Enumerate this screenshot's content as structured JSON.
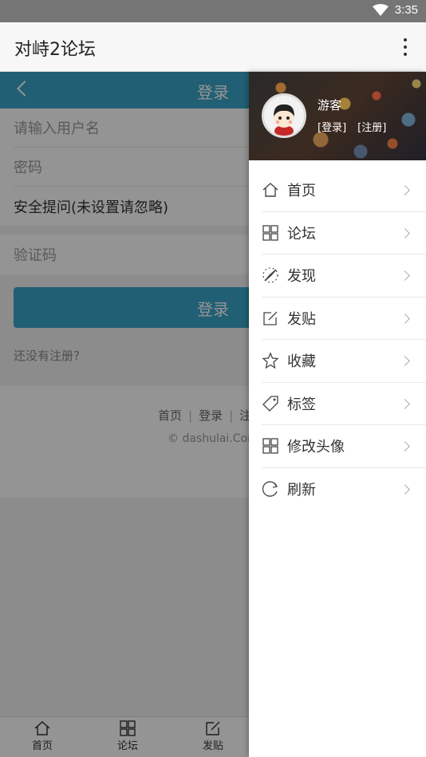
{
  "status_bar": {
    "time": "3:35"
  },
  "app_bar": {
    "title": "对峙2论坛"
  },
  "login_page": {
    "header_title": "登录",
    "username_placeholder": "请输入用户名",
    "password_placeholder": "密码",
    "security_question": "安全提问(未设置请忽略)",
    "captcha_placeholder": "验证码",
    "login_button": "登录",
    "register_prompt": "还没有注册?",
    "footer_links": [
      "首页",
      "登录",
      "注"
    ],
    "footer_copyright": "© dashulai.Com"
  },
  "bottom_nav": [
    {
      "label": "首页",
      "icon": "home-icon"
    },
    {
      "label": "论坛",
      "icon": "grid-icon"
    },
    {
      "label": "发贴",
      "icon": "edit-icon"
    }
  ],
  "drawer": {
    "username": "游客",
    "login_link": "[登录]",
    "register_link": "[注册]",
    "menu": [
      {
        "label": "首页",
        "icon": "home-icon"
      },
      {
        "label": "论坛",
        "icon": "grid-icon"
      },
      {
        "label": "发现",
        "icon": "compass-icon"
      },
      {
        "label": "发贴",
        "icon": "edit-icon"
      },
      {
        "label": "收藏",
        "icon": "star-icon"
      },
      {
        "label": "标签",
        "icon": "tag-icon"
      },
      {
        "label": "修改头像",
        "icon": "grid-icon"
      },
      {
        "label": "刷新",
        "icon": "refresh-icon"
      }
    ]
  },
  "colors": {
    "accent": "#39a4c8",
    "status_bar": "#757575"
  }
}
